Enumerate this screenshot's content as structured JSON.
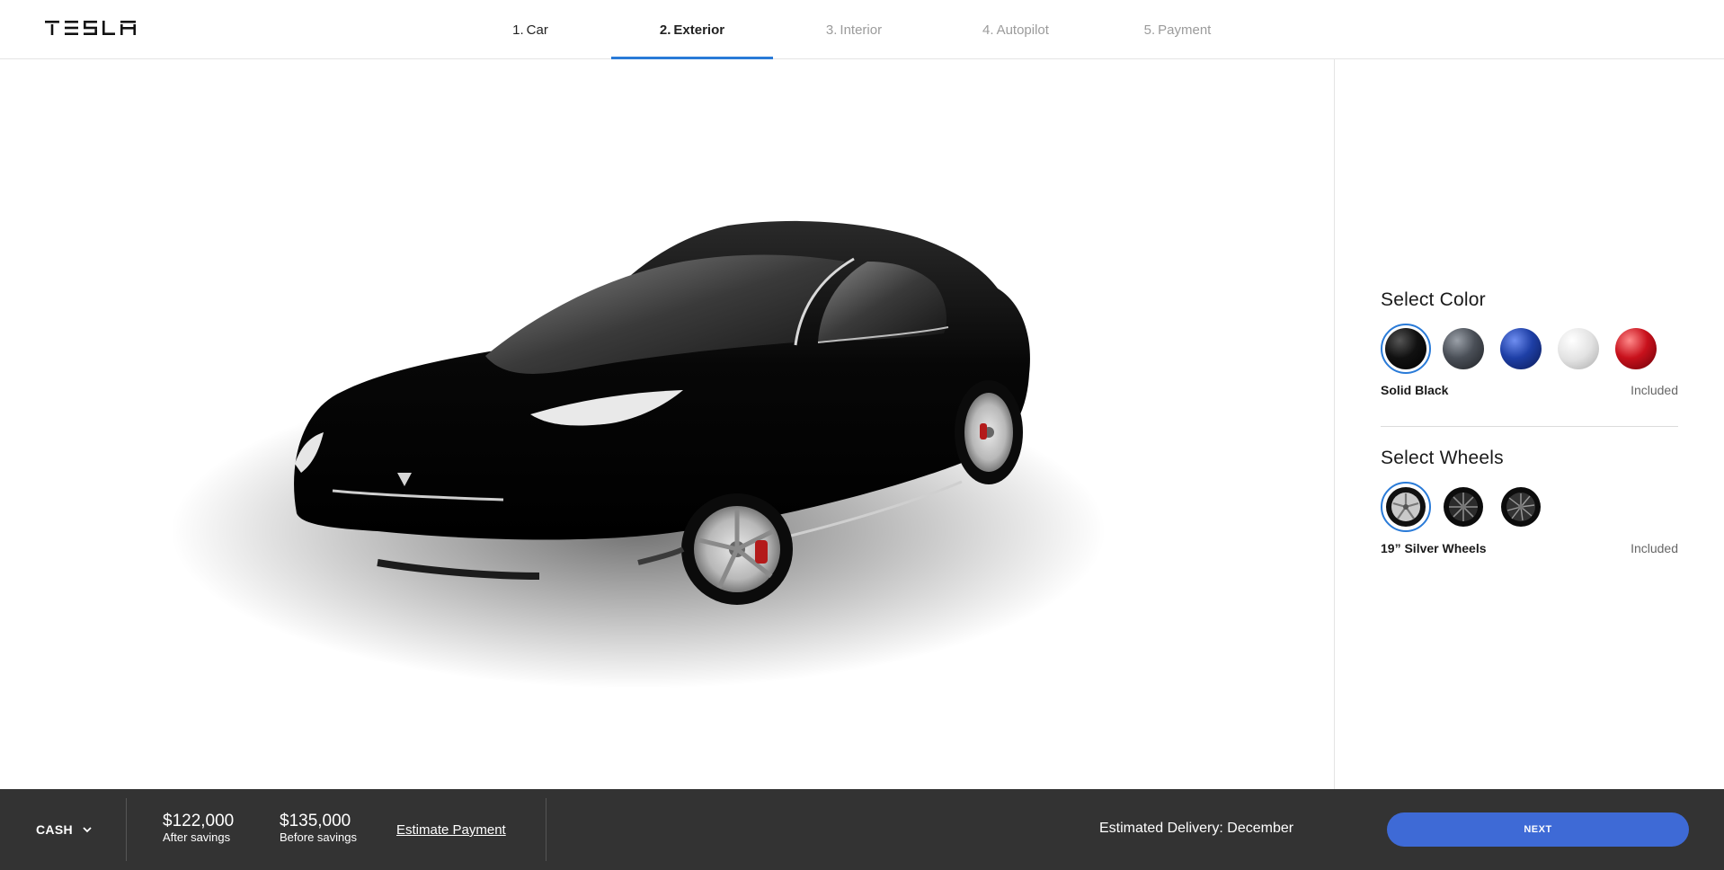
{
  "brand": {
    "logo_text": "TESLA"
  },
  "steps": [
    {
      "num": "1.",
      "label": "Car",
      "state": "done"
    },
    {
      "num": "2.",
      "label": "Exterior",
      "state": "active"
    },
    {
      "num": "3.",
      "label": "Interior",
      "state": "upcoming"
    },
    {
      "num": "4.",
      "label": "Autopilot",
      "state": "upcoming"
    },
    {
      "num": "5.",
      "label": "Payment",
      "state": "upcoming"
    }
  ],
  "colors": {
    "accent": "#2a7bd8",
    "footer_bg": "#333333",
    "next_button": "#3e6ad6"
  },
  "color_section": {
    "title": "Select Color",
    "options": [
      {
        "name": "solid-black",
        "swatch": "#111111",
        "selected": true
      },
      {
        "name": "metallic-gray",
        "swatch": "#4a4f57",
        "selected": false
      },
      {
        "name": "deep-blue",
        "swatch": "#1e3fa6",
        "selected": false
      },
      {
        "name": "pearl-white",
        "swatch": "#e2e2e2",
        "selected": false
      },
      {
        "name": "red",
        "swatch": "#c8111c",
        "selected": false
      }
    ],
    "selected_name": "Solid Black",
    "selected_price": "Included"
  },
  "wheel_section": {
    "title": "Select Wheels",
    "options": [
      {
        "name": "silver-wheel",
        "selected": true
      },
      {
        "name": "sonic-carbon-wheel",
        "selected": false
      },
      {
        "name": "turbine-wheel",
        "selected": false
      }
    ],
    "selected_name": "19” Silver Wheels",
    "selected_price": "Included"
  },
  "footer": {
    "payment_method": "CASH",
    "price_after": "$122,000",
    "price_after_label": "After savings",
    "price_before": "$135,000",
    "price_before_label": "Before savings",
    "estimate_link": "Estimate Payment",
    "delivery": "Estimated Delivery: December",
    "next_label": "NEXT"
  }
}
